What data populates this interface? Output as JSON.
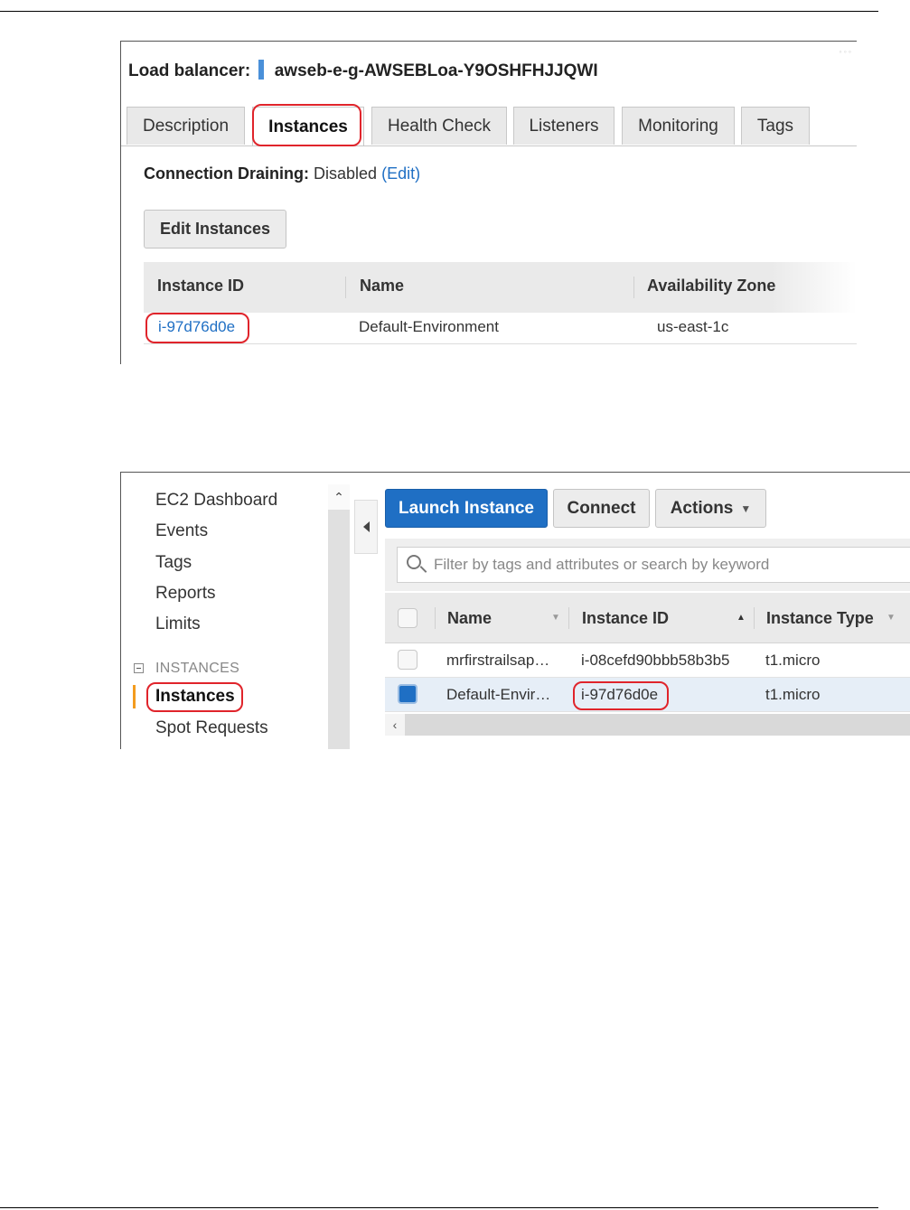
{
  "load_balancer": {
    "title_label": "Load balancer:",
    "name": "awseb-e-g-AWSEBLoa-Y9OSHFHJJQWI",
    "tabs": [
      {
        "label": "Description"
      },
      {
        "label": "Instances",
        "active": true
      },
      {
        "label": "Health Check"
      },
      {
        "label": "Listeners"
      },
      {
        "label": "Monitoring"
      },
      {
        "label": "Tags"
      }
    ],
    "connection_draining": {
      "label": "Connection Draining:",
      "value": "Disabled",
      "edit": "(Edit)"
    },
    "edit_button": "Edit Instances",
    "table": {
      "columns": [
        "Instance ID",
        "Name",
        "Availability Zone"
      ],
      "rows": [
        {
          "instance_id": "i-97d76d0e",
          "name": "Default-Environment",
          "zone": "us-east-1c"
        }
      ]
    }
  },
  "ec2": {
    "nav": {
      "items": [
        "EC2 Dashboard",
        "Events",
        "Tags",
        "Reports",
        "Limits"
      ],
      "section": "INSTANCES",
      "section_items": [
        "Instances",
        "Spot Requests"
      ]
    },
    "toolbar": {
      "launch": "Launch Instance",
      "connect": "Connect",
      "actions": "Actions"
    },
    "search_placeholder": "Filter by tags and attributes or search by keyword",
    "grid": {
      "columns": [
        "Name",
        "Instance ID",
        "Instance Type"
      ],
      "rows": [
        {
          "name": "mrfirstrailsap…",
          "instance_id": "i-08cefd90bbb58b3b5",
          "type": "t1.micro",
          "selected": false
        },
        {
          "name": "Default-Envir…",
          "instance_id": "i-97d76d0e",
          "type": "t1.micro",
          "selected": true
        }
      ]
    },
    "colors": {
      "primary": "#1f6fc4",
      "nav_accent": "#f39c1f",
      "highlight": "#e0242b"
    }
  }
}
